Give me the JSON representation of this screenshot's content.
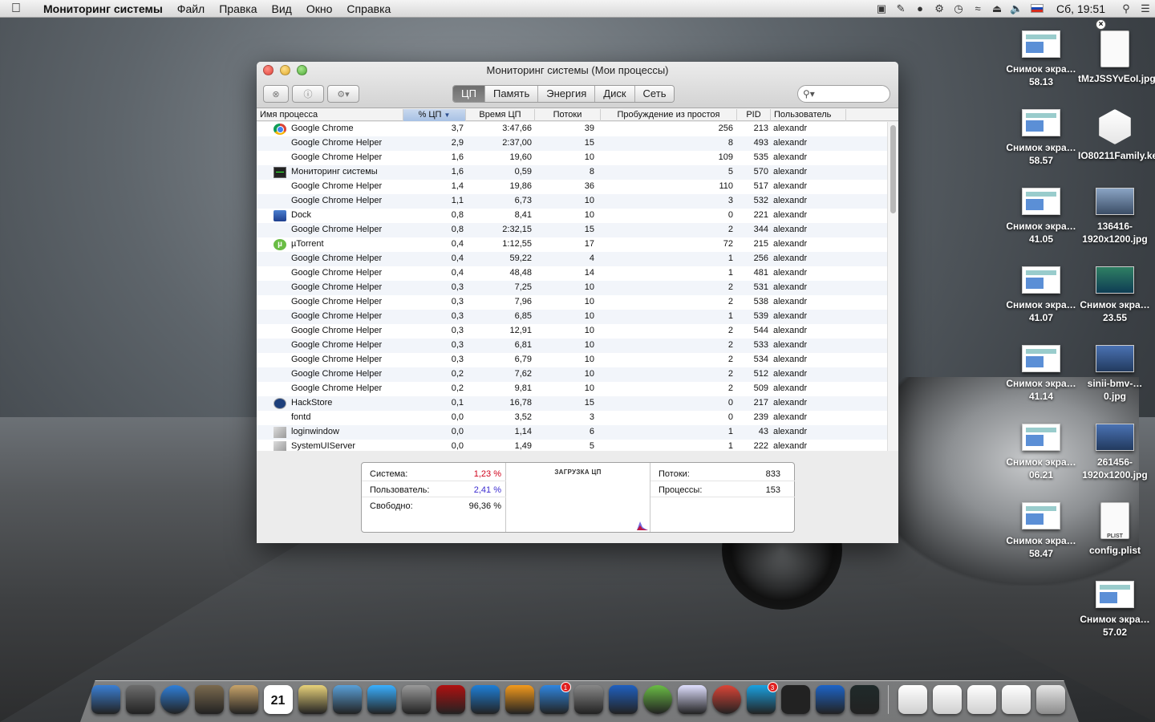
{
  "menubar": {
    "app_name": "Мониторинг системы",
    "menus": [
      "Файл",
      "Правка",
      "Вид",
      "Окно",
      "Справка"
    ],
    "clock": "Сб, 19:51"
  },
  "window": {
    "title": "Мониторинг системы (Мои процессы)",
    "tabs": [
      "ЦП",
      "Память",
      "Энергия",
      "Диск",
      "Сеть"
    ],
    "active_tab": "ЦП"
  },
  "table": {
    "headers": {
      "name": "Имя процесса",
      "cpu": "% ЦП",
      "time": "Время ЦП",
      "threads": "Потоки",
      "wakeups": "Пробуждение из простоя",
      "pid": "PID",
      "user": "Пользователь"
    },
    "rows": [
      {
        "icon": "chrome-icon",
        "name": "Google Chrome",
        "cpu": "3,7",
        "time": "3:47,66",
        "threads": "39",
        "wakeups": "256",
        "pid": "213",
        "user": "alexandr"
      },
      {
        "icon": "",
        "name": "Google Chrome Helper",
        "cpu": "2,9",
        "time": "2:37,00",
        "threads": "15",
        "wakeups": "8",
        "pid": "493",
        "user": "alexandr"
      },
      {
        "icon": "",
        "name": "Google Chrome Helper",
        "cpu": "1,6",
        "time": "19,60",
        "threads": "10",
        "wakeups": "109",
        "pid": "535",
        "user": "alexandr"
      },
      {
        "icon": "activity-monitor-icon",
        "name": "Мониторинг системы",
        "cpu": "1,6",
        "time": "0,59",
        "threads": "8",
        "wakeups": "5",
        "pid": "570",
        "user": "alexandr"
      },
      {
        "icon": "",
        "name": "Google Chrome Helper",
        "cpu": "1,4",
        "time": "19,86",
        "threads": "36",
        "wakeups": "110",
        "pid": "517",
        "user": "alexandr"
      },
      {
        "icon": "",
        "name": "Google Chrome Helper",
        "cpu": "1,1",
        "time": "6,73",
        "threads": "10",
        "wakeups": "3",
        "pid": "532",
        "user": "alexandr"
      },
      {
        "icon": "dock-icon",
        "name": "Dock",
        "cpu": "0,8",
        "time": "8,41",
        "threads": "10",
        "wakeups": "0",
        "pid": "221",
        "user": "alexandr"
      },
      {
        "icon": "",
        "name": "Google Chrome Helper",
        "cpu": "0,8",
        "time": "2:32,15",
        "threads": "15",
        "wakeups": "2",
        "pid": "344",
        "user": "alexandr"
      },
      {
        "icon": "utorrent-icon",
        "name": "µTorrent",
        "cpu": "0,4",
        "time": "1:12,55",
        "threads": "17",
        "wakeups": "72",
        "pid": "215",
        "user": "alexandr"
      },
      {
        "icon": "",
        "name": "Google Chrome Helper",
        "cpu": "0,4",
        "time": "59,22",
        "threads": "4",
        "wakeups": "1",
        "pid": "256",
        "user": "alexandr"
      },
      {
        "icon": "",
        "name": "Google Chrome Helper",
        "cpu": "0,4",
        "time": "48,48",
        "threads": "14",
        "wakeups": "1",
        "pid": "481",
        "user": "alexandr"
      },
      {
        "icon": "",
        "name": "Google Chrome Helper",
        "cpu": "0,3",
        "time": "7,25",
        "threads": "10",
        "wakeups": "2",
        "pid": "531",
        "user": "alexandr"
      },
      {
        "icon": "",
        "name": "Google Chrome Helper",
        "cpu": "0,3",
        "time": "7,96",
        "threads": "10",
        "wakeups": "2",
        "pid": "538",
        "user": "alexandr"
      },
      {
        "icon": "",
        "name": "Google Chrome Helper",
        "cpu": "0,3",
        "time": "6,85",
        "threads": "10",
        "wakeups": "1",
        "pid": "539",
        "user": "alexandr"
      },
      {
        "icon": "",
        "name": "Google Chrome Helper",
        "cpu": "0,3",
        "time": "12,91",
        "threads": "10",
        "wakeups": "2",
        "pid": "544",
        "user": "alexandr"
      },
      {
        "icon": "",
        "name": "Google Chrome Helper",
        "cpu": "0,3",
        "time": "6,81",
        "threads": "10",
        "wakeups": "2",
        "pid": "533",
        "user": "alexandr"
      },
      {
        "icon": "",
        "name": "Google Chrome Helper",
        "cpu": "0,3",
        "time": "6,79",
        "threads": "10",
        "wakeups": "2",
        "pid": "534",
        "user": "alexandr"
      },
      {
        "icon": "",
        "name": "Google Chrome Helper",
        "cpu": "0,2",
        "time": "7,62",
        "threads": "10",
        "wakeups": "2",
        "pid": "512",
        "user": "alexandr"
      },
      {
        "icon": "",
        "name": "Google Chrome Helper",
        "cpu": "0,2",
        "time": "9,81",
        "threads": "10",
        "wakeups": "2",
        "pid": "509",
        "user": "alexandr"
      },
      {
        "icon": "hackstore-icon",
        "name": "HackStore",
        "cpu": "0,1",
        "time": "16,78",
        "threads": "15",
        "wakeups": "0",
        "pid": "217",
        "user": "alexandr"
      },
      {
        "icon": "",
        "name": "fontd",
        "cpu": "0,0",
        "time": "3,52",
        "threads": "3",
        "wakeups": "0",
        "pid": "239",
        "user": "alexandr"
      },
      {
        "icon": "loginwindow-icon",
        "name": "loginwindow",
        "cpu": "0,0",
        "time": "1,14",
        "threads": "6",
        "wakeups": "1",
        "pid": "43",
        "user": "alexandr"
      },
      {
        "icon": "loginwindow-icon",
        "name": "SystemUIServer",
        "cpu": "0,0",
        "time": "1,49",
        "threads": "5",
        "wakeups": "1",
        "pid": "222",
        "user": "alexandr"
      }
    ]
  },
  "stats": {
    "system_label": "Система:",
    "system_value": "1,23 %",
    "system_color": "#d0021b",
    "user_label": "Пользователь:",
    "user_value": "2,41 %",
    "user_color": "#3b2bd0",
    "idle_label": "Свободно:",
    "idle_value": "96,36 %",
    "graph_caption": "ЗАГРУЗКА ЦП",
    "threads_label": "Потоки:",
    "threads_value": "833",
    "processes_label": "Процессы:",
    "processes_value": "153"
  },
  "desktop": {
    "icons": [
      {
        "type": "shot",
        "label": "Снимок экра…58.13"
      },
      {
        "type": "doc",
        "label": "tMzJSSYvEoI.jpg"
      },
      {
        "type": "shot",
        "label": "Снимок экра…58.57"
      },
      {
        "type": "kext",
        "label": "IO80211Family.kext"
      },
      {
        "type": "shot",
        "label": "Снимок экра…41.05"
      },
      {
        "type": "photo",
        "label": "136416-1920x1200.jpg"
      },
      {
        "type": "shot",
        "label": "Снимок экра…41.07"
      },
      {
        "type": "green",
        "label": "Снимок экра…23.55"
      },
      {
        "type": "shot",
        "label": "Снимок экра…41.14"
      },
      {
        "type": "photo2",
        "label": "sinii-bmv-…0.jpg"
      },
      {
        "type": "shot",
        "label": "Снимок экра…06.21"
      },
      {
        "type": "photo2",
        "label": "261456-1920x1200.jpg"
      },
      {
        "type": "shot",
        "label": "Снимок экра…58.47"
      },
      {
        "type": "plist",
        "label": "config.plist"
      },
      {
        "type": "shot",
        "label": "Снимок экра…57.02"
      }
    ],
    "plist_badge": "PLIST"
  },
  "dock": {
    "calendar_day": "21",
    "appstore_badge": "1",
    "skype_badge": "3",
    "colors": [
      "#3b7fd4",
      "#6d6d6d",
      "#2f7fd9",
      "#7b6a4f",
      "#c8a46a",
      "#f0f0f0",
      "#e8d27a",
      "#5aa0d8",
      "#3ab0ff",
      "#9a9a9a",
      "#b01010",
      "#1e7fd8",
      "#f39a1d",
      "#2f86e0",
      "#888888",
      "#2060c0",
      "#6abd45",
      "#e0e0ff",
      "#db4437",
      "#1aa1e1",
      "#222222",
      "#1d64c8",
      "#1f2a2a"
    ]
  }
}
